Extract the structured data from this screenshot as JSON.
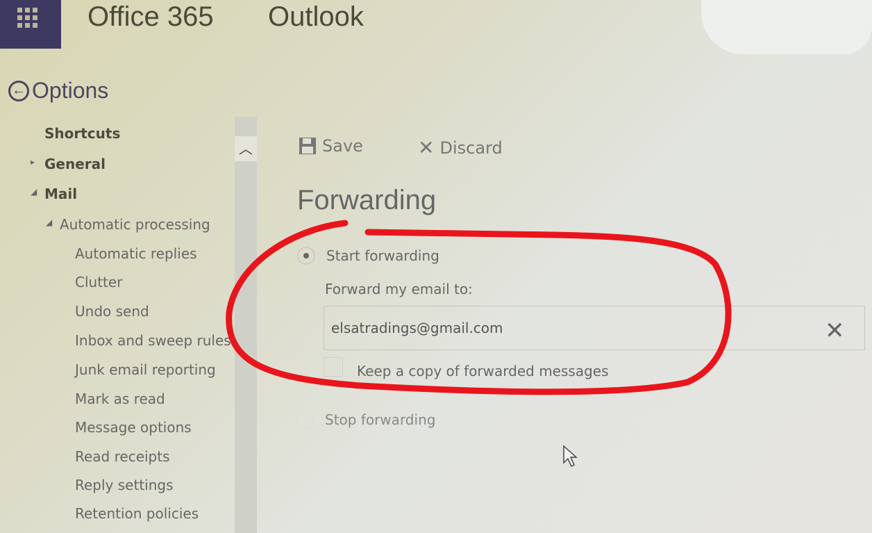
{
  "header": {
    "app_launcher_icon": "waffle-grid-icon",
    "brand": "Office 365",
    "app": "Outlook"
  },
  "options": {
    "back_icon": "circle-arrow-left-icon",
    "title": "Options"
  },
  "sidebar": {
    "items": [
      {
        "label": "Shortcuts",
        "level": 0
      },
      {
        "label": "General",
        "level": 0,
        "expander": "▸"
      },
      {
        "label": "Mail",
        "level": 0,
        "expander": "◢"
      },
      {
        "label": "Automatic processing",
        "level": 1,
        "expander": "◢"
      },
      {
        "label": "Automatic replies",
        "level": 2
      },
      {
        "label": "Clutter",
        "level": 2
      },
      {
        "label": "Undo send",
        "level": 2
      },
      {
        "label": "Inbox and sweep rules",
        "level": 2
      },
      {
        "label": "Junk email reporting",
        "level": 2
      },
      {
        "label": "Mark as read",
        "level": 2
      },
      {
        "label": "Message options",
        "level": 2
      },
      {
        "label": "Read receipts",
        "level": 2
      },
      {
        "label": "Reply settings",
        "level": 2
      },
      {
        "label": "Retention policies",
        "level": 2
      }
    ]
  },
  "toolbar": {
    "save_label": "Save",
    "discard_label": "Discard"
  },
  "main": {
    "title": "Forwarding",
    "start_forwarding": "Start forwarding",
    "start_selected": true,
    "forward_label": "Forward my email to:",
    "email_value": "elsatradings@gmail.com",
    "keep_copy_label": "Keep a copy of forwarded messages",
    "keep_copy_checked": false,
    "stop_forwarding": "Stop forwarding"
  },
  "annotation_color": "#e8161c"
}
